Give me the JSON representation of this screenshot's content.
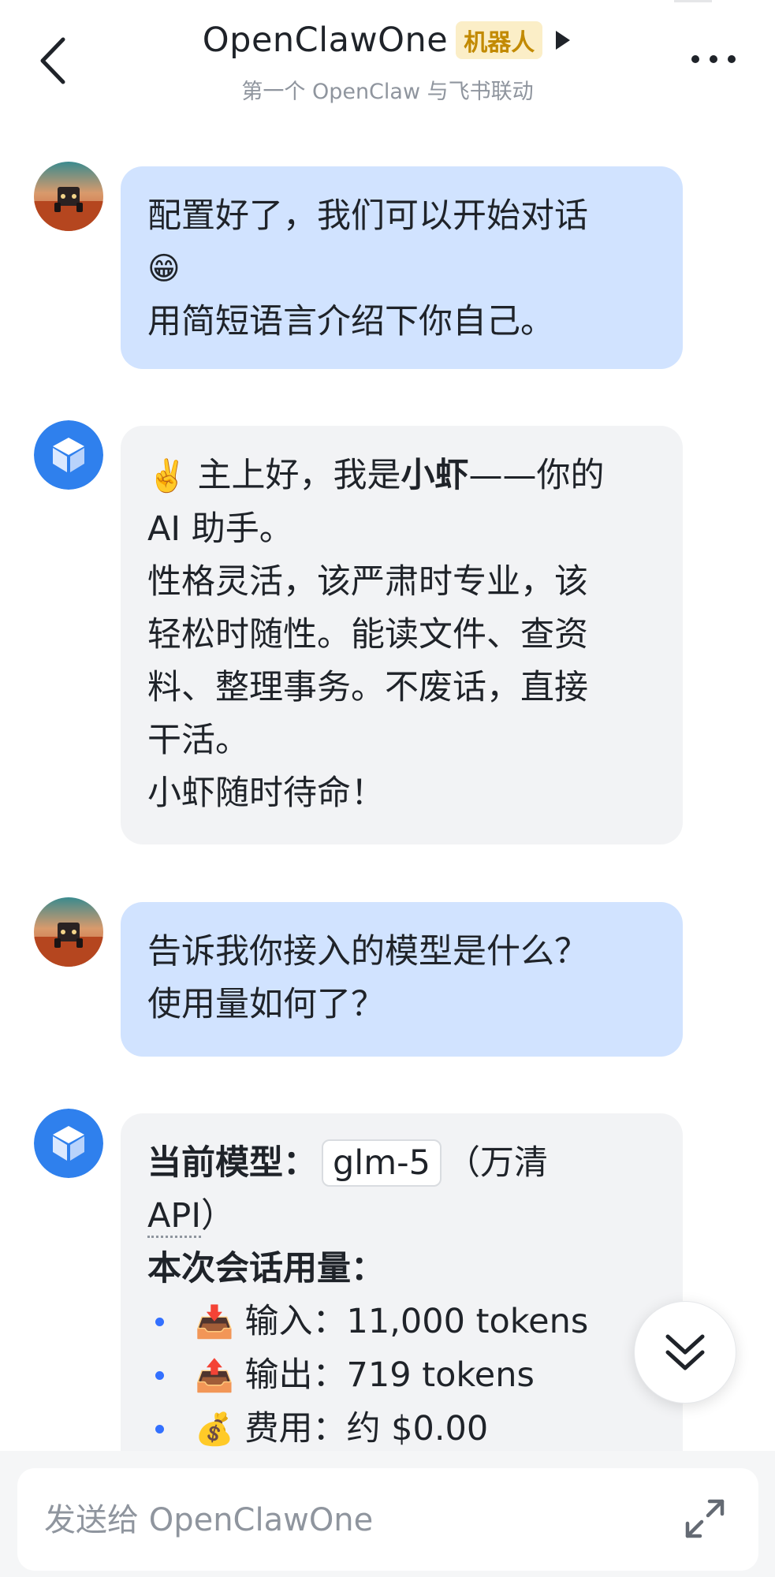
{
  "header": {
    "title": "OpenClawOne",
    "badge": "机器人",
    "subtitle": "第一个 OpenClaw 与飞书联动",
    "back_icon": "chevron-left-icon",
    "more_icon": "more-dots-icon"
  },
  "messages": [
    {
      "sender": "user",
      "lines": [
        "配置好了，我们可以开始对话",
        "😁",
        "用简短语言介绍下你自己。"
      ]
    },
    {
      "sender": "bot",
      "intro_emoji": "✌️",
      "intro_pre": "主上好，我是",
      "intro_bold": "小虾",
      "intro_post": "——你的",
      "intro_line2": "AI 助手。",
      "body_lines": [
        "性格灵活，该严肃时专业，该",
        "轻松时随性。能读文件、查资",
        "料、整理事务。不废话，直接",
        "干活。"
      ],
      "closing": "小虾随时待命！"
    },
    {
      "sender": "user",
      "lines": [
        "告诉我你接入的模型是什么？",
        "使用量如何了？"
      ]
    },
    {
      "sender": "bot",
      "model_label": "当前模型：",
      "model_name": "glm-5",
      "model_suffix": "（万清",
      "model_api": "API",
      "model_close": "）",
      "usage_title": "本次会话用量：",
      "usage_items": [
        {
          "emoji": "📥",
          "text": "输入：11,000 tokens"
        },
        {
          "emoji": "📤",
          "text": "输出：719 tokens"
        },
        {
          "emoji": "💰",
          "text": "费用：约 $0.00"
        }
      ]
    }
  ],
  "composer": {
    "placeholder": "发送给 OpenClawOne",
    "expand_icon": "expand-arrows-icon"
  },
  "scroll_button_icon": "double-chevron-down-icon",
  "colors": {
    "user_bubble": "#d1e3ff",
    "bot_bubble": "#f2f3f5",
    "badge_bg": "#fbeec7",
    "badge_text": "#c28a00",
    "bullet": "#3370ff"
  }
}
